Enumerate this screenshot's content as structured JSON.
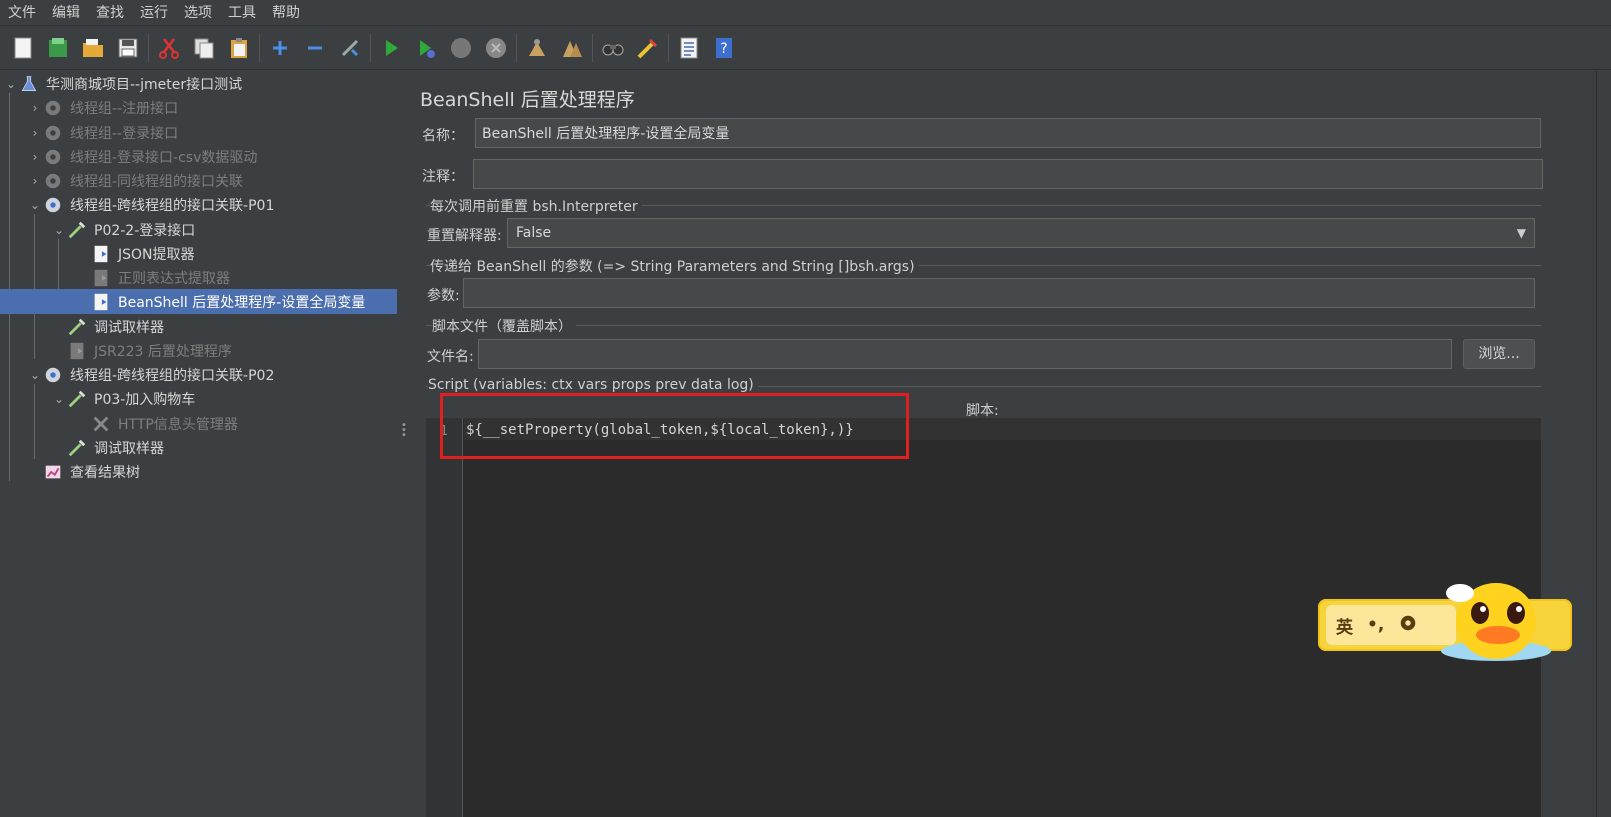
{
  "menu": [
    "文件",
    "编辑",
    "查找",
    "运行",
    "选项",
    "工具",
    "帮助"
  ],
  "toolbar_icons": [
    "new-icon",
    "templates-icon",
    "open-icon",
    "save-icon",
    "cut-icon",
    "copy-icon",
    "paste-icon",
    "add-icon",
    "remove-icon",
    "toggle-icon",
    "start-icon",
    "start-no-pause-icon",
    "stop-icon",
    "shutdown-icon",
    "clear-icon",
    "clear-all-icon",
    "search-icon",
    "reset-search-icon",
    "function-helper-icon",
    "help-icon"
  ],
  "tree": {
    "root": "华测商城项目--jmeter接口测试",
    "items": [
      {
        "label": "线程组--注册接口",
        "disabled": true
      },
      {
        "label": "线程组--登录接口",
        "disabled": true
      },
      {
        "label": "线程组-登录接口-csv数据驱动",
        "disabled": true
      },
      {
        "label": "线程组-同线程组的接口关联",
        "disabled": true
      },
      {
        "label": "线程组-跨线程组的接口关联-P01",
        "disabled": false
      },
      {
        "label": "P02-2-登录接口",
        "disabled": false
      },
      {
        "label": "JSON提取器",
        "disabled": false
      },
      {
        "label": "正则表达式提取器",
        "disabled": true
      },
      {
        "label": "BeanShell 后置处理程序-设置全局变量",
        "disabled": false
      },
      {
        "label": "调试取样器",
        "disabled": false
      },
      {
        "label": "JSR223 后置处理程序",
        "disabled": true
      },
      {
        "label": "线程组-跨线程组的接口关联-P02",
        "disabled": false
      },
      {
        "label": "P03-加入购物车",
        "disabled": false
      },
      {
        "label": "HTTP信息头管理器",
        "disabled": true
      },
      {
        "label": "调试取样器",
        "disabled": false
      },
      {
        "label": "查看结果树",
        "disabled": false
      }
    ]
  },
  "panel": {
    "title": "BeanShell 后置处理程序",
    "name_label": "名称：",
    "name_value": "BeanShell 后置处理程序-设置全局变量",
    "comment_label": "注释：",
    "comment_value": "",
    "reset_group": "每次调用前重置 bsh.Interpreter",
    "reset_label": "重置解释器:",
    "reset_value": "False",
    "params_group": "传递给 BeanShell 的参数 (=> String Parameters and String []bsh.args)",
    "params_label": "参数:",
    "params_value": "",
    "file_group": "脚本文件（覆盖脚本）",
    "file_label": "文件名:",
    "file_value": "",
    "browse_label": "浏览...",
    "script_group": "Script (variables: ctx vars props prev data log)",
    "script_label": "脚本:",
    "line_number": "1",
    "script_code": "${__setProperty(global_token,${local_token},)}"
  },
  "ime": {
    "lang": "英",
    "punct": "•,",
    "settings_icon": "gear-icon"
  },
  "colors": {
    "selection": "#4b6eaf",
    "highlight_box": "#e02020",
    "background": "#3c3f41"
  }
}
